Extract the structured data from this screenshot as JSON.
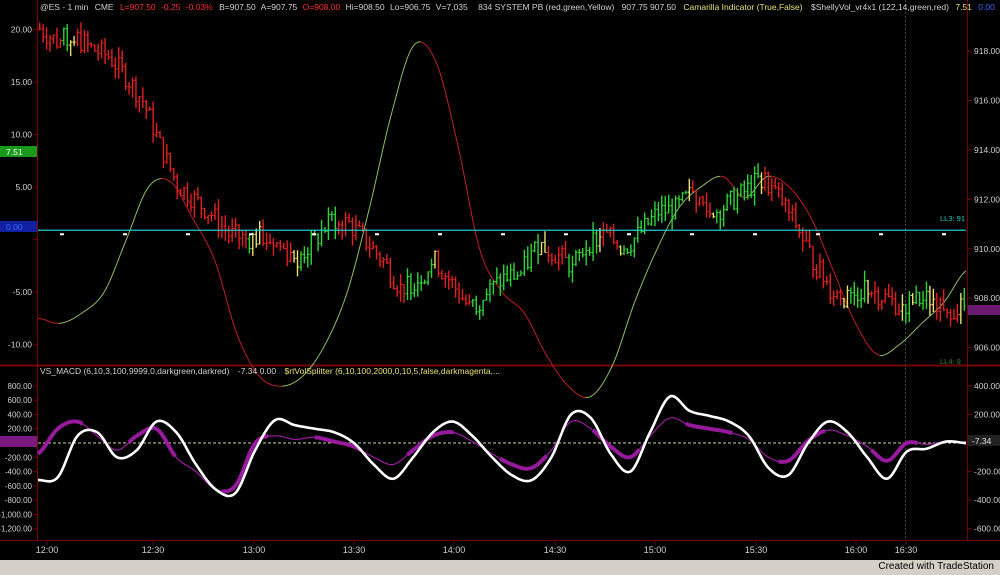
{
  "header": {
    "symbol": "@ES - 1 min",
    "exchange": "CME",
    "last": "L=907.50",
    "change": "-0.25",
    "change_pct": "-0.03%",
    "bid": "B=907.50",
    "ask": "A=907.75",
    "open": "O=908.00",
    "high": "Hi=908.50",
    "low": "Lo=906.75",
    "volume": "V=7,035",
    "study1": "834 SYSTEM PB (red,green,Yellow)",
    "study1_vals": "907.75  907.50",
    "study2": "Camarilla Indicator (True,False)",
    "study3": "$ShellyVol_vr4x1 (122,14,green,red)",
    "study3_v1": "7.51",
    "study3_v2": "0.00"
  },
  "lower_header": {
    "study1": "VS_MACD (6,10,3,100,9999,0,darkgreen,darkred)",
    "study1_vals": "-7.34  0.00",
    "study2": "$rtVolSplitter (6,10,100,2000,0,10,5,false,darkmagenta,..."
  },
  "labels": {
    "left_badge_top": "7.51",
    "left_badge_mid": "0.00",
    "right_badge_mid": "-7.34",
    "ll3": "LL3: 91",
    "hh3": "LL4: 9",
    "footer": "Created with TradeStation"
  },
  "colors": {
    "background": "#000000",
    "bull": "#2fd43a",
    "bear": "#e02020",
    "neutral": "#e8e070",
    "camarilla": "#20c8c8",
    "vol_up": "#8fc060",
    "vol_down": "#c02020",
    "macd": "#ffffff",
    "splitter": "#9a1aa0",
    "axis_text": "#d0d0d0",
    "grid": "#7a0000"
  },
  "chart_data": [
    {
      "type": "candlestick",
      "panel": "price",
      "right_axis": {
        "ticks": [
          906,
          908,
          910,
          912,
          914,
          916,
          918
        ],
        "range": [
          905.5,
          919.5
        ]
      },
      "left_axis": {
        "ticks": [
          -10,
          -5,
          0,
          5,
          10,
          15,
          20
        ],
        "tick_labels": [
          "-10.00",
          "-5.00",
          "",
          "5.00",
          "10.00",
          "15.00",
          "20.00"
        ],
        "range": [
          -11.5,
          21.5
        ]
      },
      "x_ticks": [
        "12:00",
        "12:30",
        "13:00",
        "13:30",
        "14:00",
        "14:30",
        "15:00",
        "15:30",
        "16:00",
        "16:30"
      ],
      "camarilla_level": 910.75,
      "close_path": [
        [
          0,
          918.9
        ],
        [
          5,
          918.4
        ],
        [
          10,
          918.6
        ],
        [
          15,
          918.1
        ],
        [
          20,
          917.8
        ],
        [
          25,
          917.0
        ],
        [
          30,
          916.0
        ],
        [
          35,
          914.2
        ],
        [
          40,
          912.6
        ],
        [
          45,
          912.0
        ],
        [
          50,
          911.4
        ],
        [
          55,
          910.6
        ],
        [
          60,
          910.4
        ],
        [
          65,
          910.5
        ],
        [
          70,
          910.1
        ],
        [
          75,
          909.6
        ],
        [
          80,
          910.3
        ],
        [
          85,
          911.2
        ],
        [
          90,
          911.0
        ],
        [
          95,
          910.3
        ],
        [
          100,
          909.5
        ],
        [
          105,
          908.4
        ],
        [
          110,
          908.8
        ],
        [
          115,
          909.5
        ],
        [
          120,
          908.6
        ],
        [
          125,
          907.6
        ],
        [
          130,
          908.2
        ],
        [
          135,
          908.8
        ],
        [
          140,
          909.0
        ],
        [
          145,
          910.2
        ],
        [
          150,
          909.8
        ],
        [
          155,
          909.3
        ],
        [
          160,
          910.3
        ],
        [
          165,
          910.5
        ],
        [
          170,
          910.0
        ],
        [
          175,
          910.7
        ],
        [
          180,
          911.5
        ],
        [
          185,
          911.6
        ],
        [
          190,
          912.3
        ],
        [
          195,
          911.4
        ],
        [
          200,
          911.8
        ],
        [
          205,
          912.3
        ],
        [
          210,
          912.9
        ],
        [
          215,
          912.1
        ],
        [
          220,
          911.0
        ],
        [
          225,
          909.5
        ],
        [
          230,
          908.4
        ],
        [
          235,
          907.9
        ],
        [
          240,
          908.5
        ],
        [
          245,
          908.1
        ],
        [
          250,
          907.7
        ],
        [
          255,
          907.9
        ],
        [
          260,
          908.0
        ],
        [
          265,
          907.6
        ]
      ],
      "bar_count": 270,
      "series": [
        {
          "name": "$ShellyVol",
          "values_left_axis": [
            -7.5,
            -8,
            -7,
            -5,
            0,
            5,
            5.5,
            2,
            -2,
            -9,
            -13,
            -14,
            -13,
            -10,
            -5,
            3,
            12,
            18.5,
            17,
            9,
            -1,
            -5,
            -7,
            -11,
            -14,
            -15,
            -12,
            -6,
            -1,
            3,
            5,
            6,
            4,
            6,
            5,
            2,
            -3,
            -8,
            -11,
            -10,
            -8,
            -6,
            -3
          ]
        }
      ]
    },
    {
      "type": "line",
      "panel": "indicator",
      "right_axis": {
        "ticks": [
          -600,
          -400,
          -200,
          0,
          200,
          400
        ],
        "tick_labels": [
          "-600.00",
          "-400.00",
          "-200.00",
          "",
          "200.00",
          "400.00"
        ]
      },
      "left_axis": {
        "ticks": [
          -1200,
          -1000,
          -800,
          -600,
          -400,
          -200,
          0,
          200,
          400,
          600,
          800
        ],
        "tick_labels": [
          "-1,200.00",
          "-1,000.00",
          "-800.00",
          "-600.00",
          "-400.00",
          "-200.00",
          "",
          "200.00",
          "400.00",
          "600.00",
          "800.00"
        ]
      },
      "series": [
        {
          "name": "VS_MACD",
          "values": [
            -520,
            -480,
            100,
            150,
            -200,
            -100,
            300,
            150,
            -300,
            -650,
            -700,
            -100,
            320,
            250,
            200,
            150,
            0,
            -300,
            -500,
            -200,
            150,
            300,
            100,
            -200,
            -450,
            -520,
            -200,
            400,
            350,
            -150,
            -400,
            150,
            650,
            450,
            380,
            300,
            100,
            -350,
            -450,
            0,
            300,
            150,
            -200,
            -500,
            -120,
            -80,
            20,
            0
          ]
        },
        {
          "name": "$rtVolSplitter",
          "values": [
            -150,
            200,
            300,
            100,
            -100,
            100,
            200,
            -200,
            -400,
            -650,
            -600,
            0,
            100,
            50,
            80,
            20,
            -50,
            -200,
            -300,
            -100,
            100,
            150,
            20,
            -150,
            -300,
            -350,
            -100,
            300,
            200,
            -50,
            -200,
            100,
            350,
            250,
            200,
            150,
            50,
            -200,
            -250,
            30,
            180,
            100,
            -50,
            -250,
            0,
            -20,
            20,
            0
          ]
        }
      ]
    }
  ]
}
